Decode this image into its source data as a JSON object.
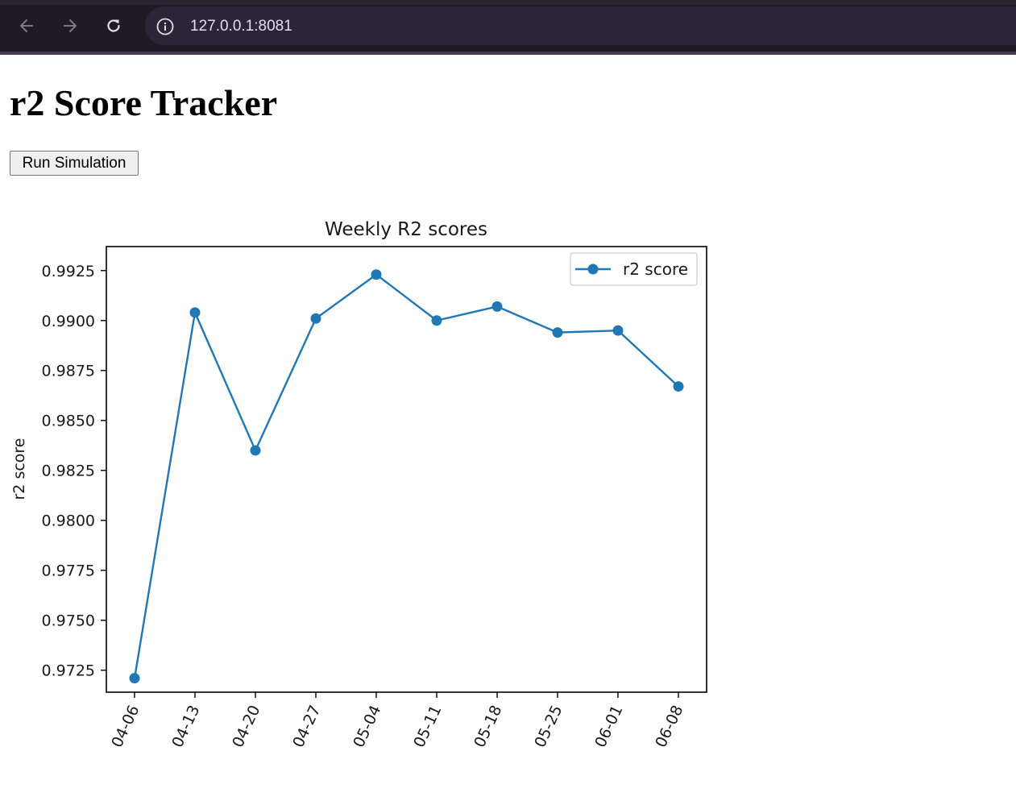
{
  "browser": {
    "url": "127.0.0.1:8081"
  },
  "page": {
    "title": "r2 Score Tracker",
    "run_button_label": "Run Simulation"
  },
  "chart_data": {
    "type": "line",
    "title": "Weekly R2 scores",
    "xlabel": "",
    "ylabel": "r2 score",
    "categories": [
      "04-06",
      "04-13",
      "04-20",
      "04-27",
      "05-04",
      "05-11",
      "05-18",
      "05-25",
      "06-01",
      "06-08"
    ],
    "series": [
      {
        "name": "r2 score",
        "values": [
          0.9721,
          0.9904,
          0.9835,
          0.9901,
          0.9923,
          0.99,
          0.9907,
          0.9894,
          0.9895,
          0.9867
        ],
        "color": "#1f77b4"
      }
    ],
    "ylim": [
      0.9714,
      0.9937
    ],
    "yticks": [
      "0.9725",
      "0.9750",
      "0.9775",
      "0.9800",
      "0.9825",
      "0.9850",
      "0.9875",
      "0.9900",
      "0.9925"
    ],
    "grid": false,
    "legend": "top-right",
    "x_tick_rotation": -65
  }
}
